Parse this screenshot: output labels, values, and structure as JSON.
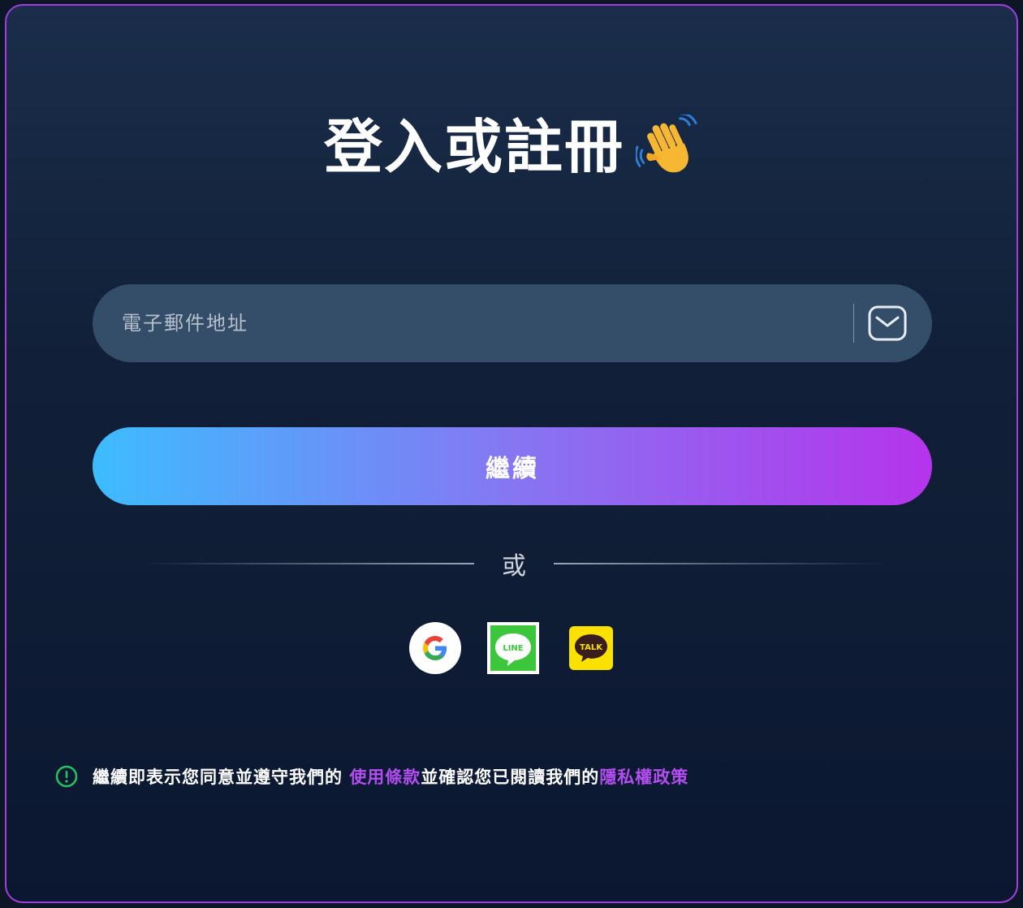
{
  "header": {
    "title": "登入或註冊",
    "emoji_icon": "waving-hand-icon"
  },
  "email": {
    "placeholder": "電子郵件地址",
    "value": "",
    "icon": "envelope-icon"
  },
  "continue_button": {
    "label": "繼續"
  },
  "divider": {
    "or_label": "或"
  },
  "social": [
    {
      "name": "google",
      "icon": "google-icon"
    },
    {
      "name": "line",
      "icon": "line-icon",
      "text": "LINE"
    },
    {
      "name": "kakaotalk",
      "icon": "kakaotalk-icon",
      "text": "TALK"
    }
  ],
  "terms": {
    "prefix": "繼續即表示您同意並遵守我們的 ",
    "terms_link": "使用條款",
    "middle": "並確認您已閱讀我們的",
    "privacy_link": "隱私權政策"
  },
  "colors": {
    "border": "#a13ee0",
    "accent_purple": "#b34ef0",
    "gradient_start": "#3dbcff",
    "gradient_end": "#b534ec",
    "alert_green": "#22c55e"
  }
}
